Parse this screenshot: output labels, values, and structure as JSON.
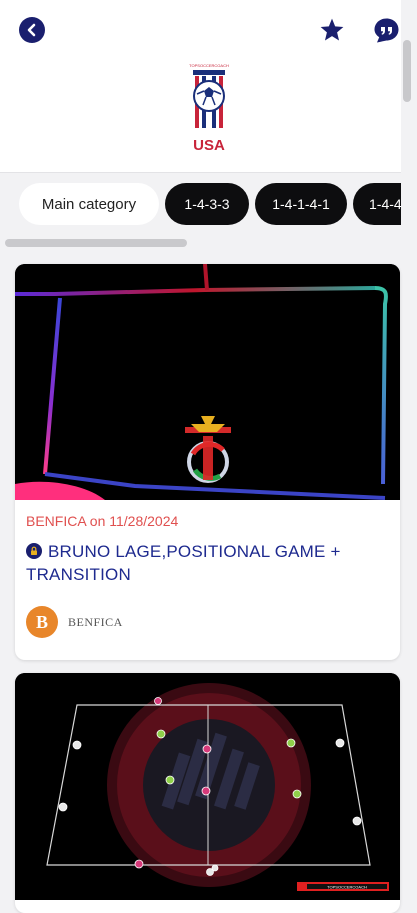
{
  "header": {
    "back_icon": "back-arrow-icon",
    "favorite_icon": "star-icon",
    "chat_icon": "quote-chat-icon",
    "logo_text": "USA",
    "logo_small_text": "TOPSOCCERCOACH",
    "accent_color": "#1a1f6e"
  },
  "categories": {
    "main_label": "Main category",
    "items": [
      "1-4-3-3",
      "1-4-1-4-1",
      "1-4-4"
    ]
  },
  "cards": [
    {
      "meta": "BENFICA on 11/28/2024",
      "title": "BRUNO LAGE,POSITIONAL GAME + TRANSITION",
      "locked": true,
      "author_initial": "B",
      "author_name": "BENFICA",
      "avatar_color": "#e8862a"
    },
    {
      "thumb_badge": "TOPSOCCERCOACH"
    }
  ]
}
